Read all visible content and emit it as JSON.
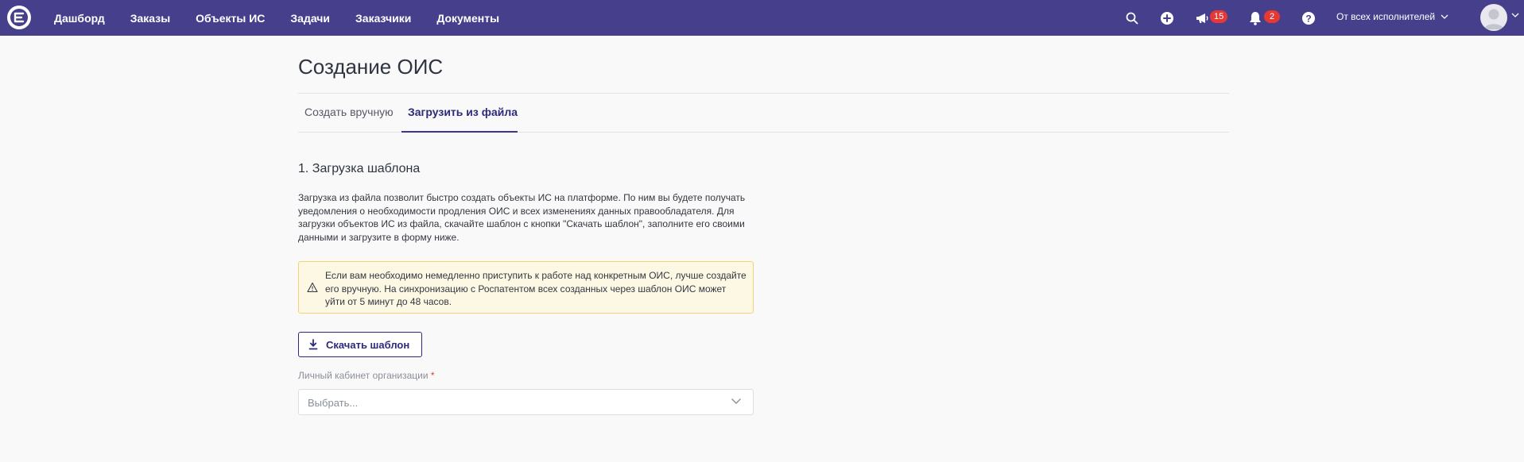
{
  "nav": {
    "items": [
      "Дашборд",
      "Заказы",
      "Объекты ИС",
      "Задачи",
      "Заказчики",
      "Документы"
    ]
  },
  "header": {
    "announcements_count": "15",
    "notifications_count": "2",
    "filter_label": "От всех исполнителей"
  },
  "page": {
    "title": "Создание ОИС",
    "tabs": [
      {
        "label": "Создать вручную",
        "active": false
      },
      {
        "label": "Загрузить из файла",
        "active": true
      }
    ]
  },
  "upload": {
    "section_title": "1. Загрузка шаблона",
    "description": "Загрузка из файла позволит быстро создать объекты ИС на платформе. По ним вы будете получать уведомления о необходимости продления ОИС и всех изменениях данных правообладателя. Для загрузки объектов ИС из файла, скачайте шаблон с кнопки \"Скачать шаблон\", заполните его своими данными и загрузите в форму ниже.",
    "alert_text": "Если вам необходимо немедленно приступить к работе над конкретным ОИС, лучше создайте его вручную. На синхронизацию с Роспатентом всех созданных через шаблон ОИС может уйти от 5 минут до 48 часов.",
    "download_button": "Скачать шаблон",
    "org_field_label": "Личный кабинет организации",
    "org_field_required": "*",
    "org_field_placeholder": "Выбрать..."
  },
  "colors": {
    "topbar": "#453f8c",
    "accent": "#2d2a7a",
    "badge": "#e53935",
    "alert_bg": "#fdf8e4",
    "alert_border": "#f2d271"
  }
}
